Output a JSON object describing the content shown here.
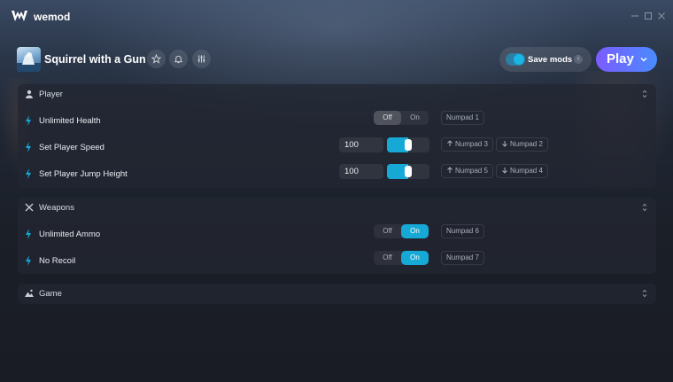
{
  "app": {
    "name": "wemod",
    "window_controls": [
      "minimize",
      "maximize",
      "close"
    ]
  },
  "game": {
    "title": "Squirrel with a Gun",
    "header_icons": [
      "star-icon",
      "bell-icon",
      "sliders-icon"
    ]
  },
  "save_mods": {
    "label": "Save mods",
    "enabled": true
  },
  "play": {
    "label": "Play"
  },
  "colors": {
    "accent": "#17a9d6",
    "play_gradient_start": "#7b5cff",
    "play_gradient_end": "#4a8bff"
  },
  "sections": [
    {
      "title": "Player",
      "icon": "user-icon",
      "mods": [
        {
          "name": "Unlimited Health",
          "type": "toggle",
          "state": "Off",
          "off_label": "Off",
          "on_label": "On",
          "hotkeys": [
            {
              "label": "Numpad 1"
            }
          ]
        },
        {
          "name": "Set Player Speed",
          "type": "slider",
          "value": "100",
          "fill_percent": 50,
          "hotkeys": [
            {
              "dir": "up",
              "label": "Numpad 3"
            },
            {
              "dir": "down",
              "label": "Numpad 2"
            }
          ]
        },
        {
          "name": "Set Player Jump Height",
          "type": "slider",
          "value": "100",
          "fill_percent": 50,
          "hotkeys": [
            {
              "dir": "up",
              "label": "Numpad 5"
            },
            {
              "dir": "down",
              "label": "Numpad 4"
            }
          ]
        }
      ]
    },
    {
      "title": "Weapons",
      "icon": "crossed-swords-icon",
      "mods": [
        {
          "name": "Unlimited Ammo",
          "type": "toggle",
          "state": "On",
          "off_label": "Off",
          "on_label": "On",
          "hotkeys": [
            {
              "label": "Numpad 6"
            }
          ]
        },
        {
          "name": "No Recoil",
          "type": "toggle",
          "state": "On",
          "off_label": "Off",
          "on_label": "On",
          "hotkeys": [
            {
              "label": "Numpad 7"
            }
          ]
        }
      ]
    },
    {
      "title": "Game",
      "icon": "landscape-icon",
      "mods": []
    }
  ]
}
